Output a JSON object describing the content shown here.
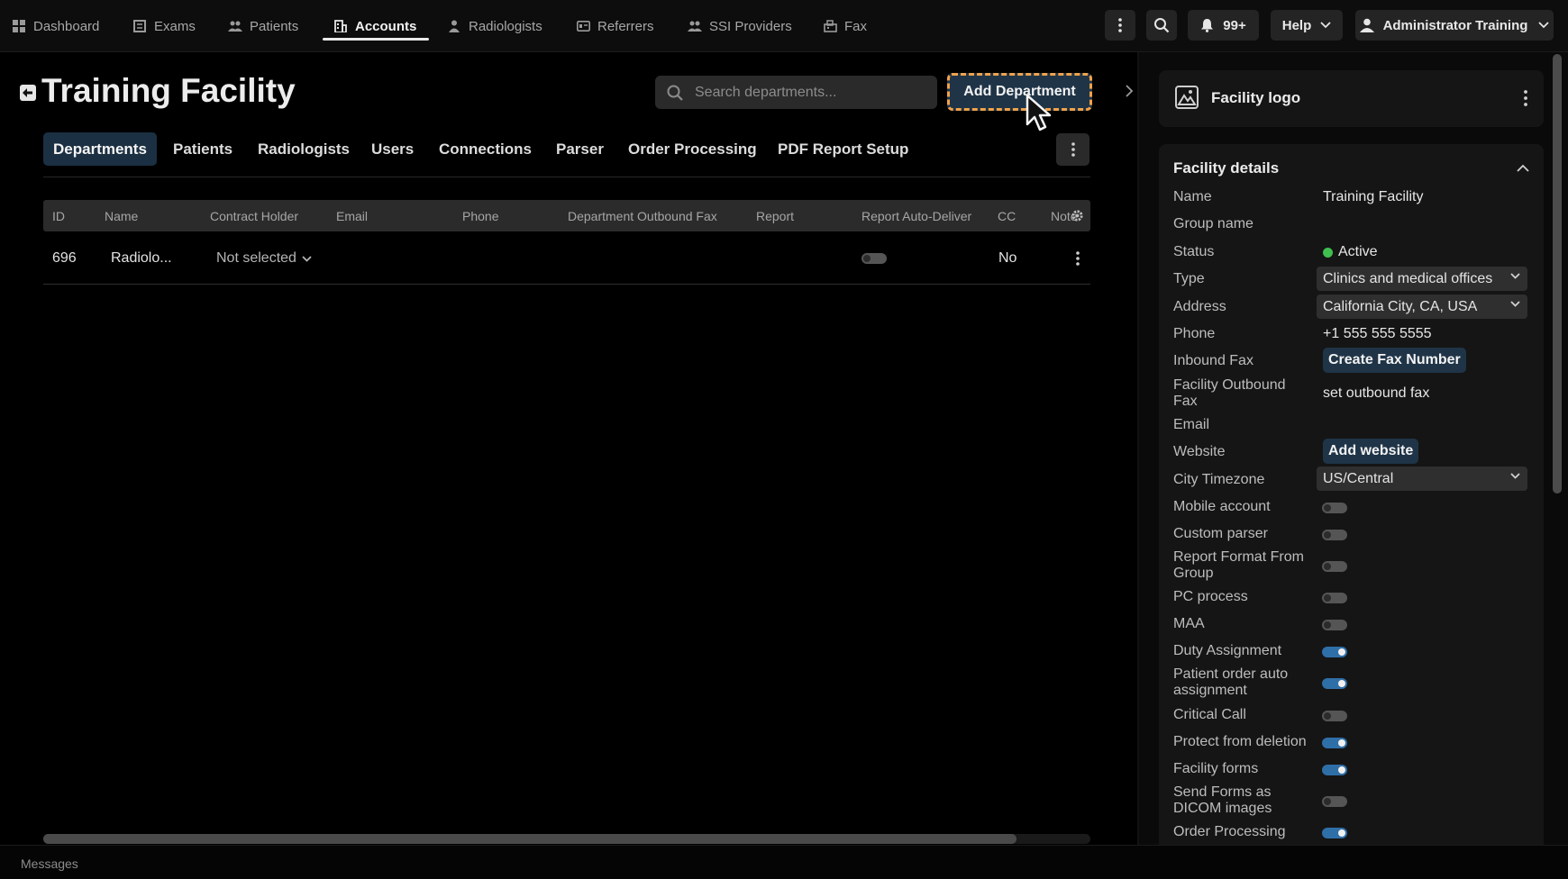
{
  "nav": {
    "tabs": [
      {
        "label": "Dashboard",
        "icon": "dashboard-icon"
      },
      {
        "label": "Exams",
        "icon": "exams-icon"
      },
      {
        "label": "Patients",
        "icon": "patients-icon"
      },
      {
        "label": "Accounts",
        "icon": "accounts-icon",
        "active": true
      },
      {
        "label": "Radiologists",
        "icon": "radiologists-icon"
      },
      {
        "label": "Referrers",
        "icon": "referrers-icon"
      },
      {
        "label": "SSI Providers",
        "icon": "ssi-providers-icon"
      },
      {
        "label": "Fax",
        "icon": "fax-icon"
      }
    ],
    "notifications_count": "99+",
    "help_label": "Help",
    "user_label": "Administrator Training"
  },
  "main": {
    "title": "Training Facility",
    "search_placeholder": "Search departments...",
    "add_button_label": "Add Department",
    "tabs": [
      "Departments",
      "Patients",
      "Radiologists",
      "Users",
      "Connections",
      "Parser",
      "Order Processing",
      "PDF Report Setup"
    ],
    "active_tab": "Departments",
    "table": {
      "columns": [
        "ID",
        "Name",
        "Contract Holder",
        "Email",
        "Phone",
        "Department Outbound Fax",
        "Report",
        "Report Auto-Deliver",
        "CC",
        "Notes"
      ],
      "rows": [
        {
          "id": "696",
          "name": "Radiolo...",
          "contract_holder": "Not selected",
          "email": "",
          "phone": "",
          "outbound_fax": "",
          "report": "",
          "auto_deliver": false,
          "cc": "No"
        }
      ]
    }
  },
  "panel": {
    "logo_title": "Facility logo",
    "details_title": "Facility details",
    "fields": {
      "name_label": "Name",
      "name_value": "Training Facility",
      "group_label": "Group name",
      "status_label": "Status",
      "status_value": "Active",
      "type_label": "Type",
      "type_value": "Clinics and medical offices",
      "address_label": "Address",
      "address_value": "California City, CA, USA",
      "phone_label": "Phone",
      "phone_value": "+1 555 555 5555",
      "inbound_fax_label": "Inbound Fax",
      "inbound_fax_button": "Create Fax Number",
      "outbound_fax_label": "Facility Outbound Fax",
      "outbound_fax_value": "set outbound fax",
      "email_label": "Email",
      "website_label": "Website",
      "website_button": "Add website",
      "timezone_label": "City Timezone",
      "timezone_value": "US/Central"
    },
    "toggles": [
      {
        "label": "Mobile account",
        "on": false
      },
      {
        "label": "Custom parser",
        "on": false
      },
      {
        "label": "Report Format From Group",
        "on": false
      },
      {
        "label": "PC process",
        "on": false
      },
      {
        "label": "MAA",
        "on": false
      },
      {
        "label": "Duty Assignment",
        "on": true
      },
      {
        "label": "Patient order auto assignment",
        "on": true
      },
      {
        "label": "Critical Call",
        "on": false
      },
      {
        "label": "Protect from deletion",
        "on": true
      },
      {
        "label": "Facility forms",
        "on": true
      },
      {
        "label": "Send Forms as DICOM images",
        "on": false
      },
      {
        "label": "Order Processing",
        "on": true
      }
    ]
  },
  "footer": {
    "label": "Messages"
  },
  "colors": {
    "accent": "#2f6fa8",
    "button_bg": "#1f3447",
    "highlight": "#f0a24a",
    "status_active": "#3fbf4f"
  }
}
